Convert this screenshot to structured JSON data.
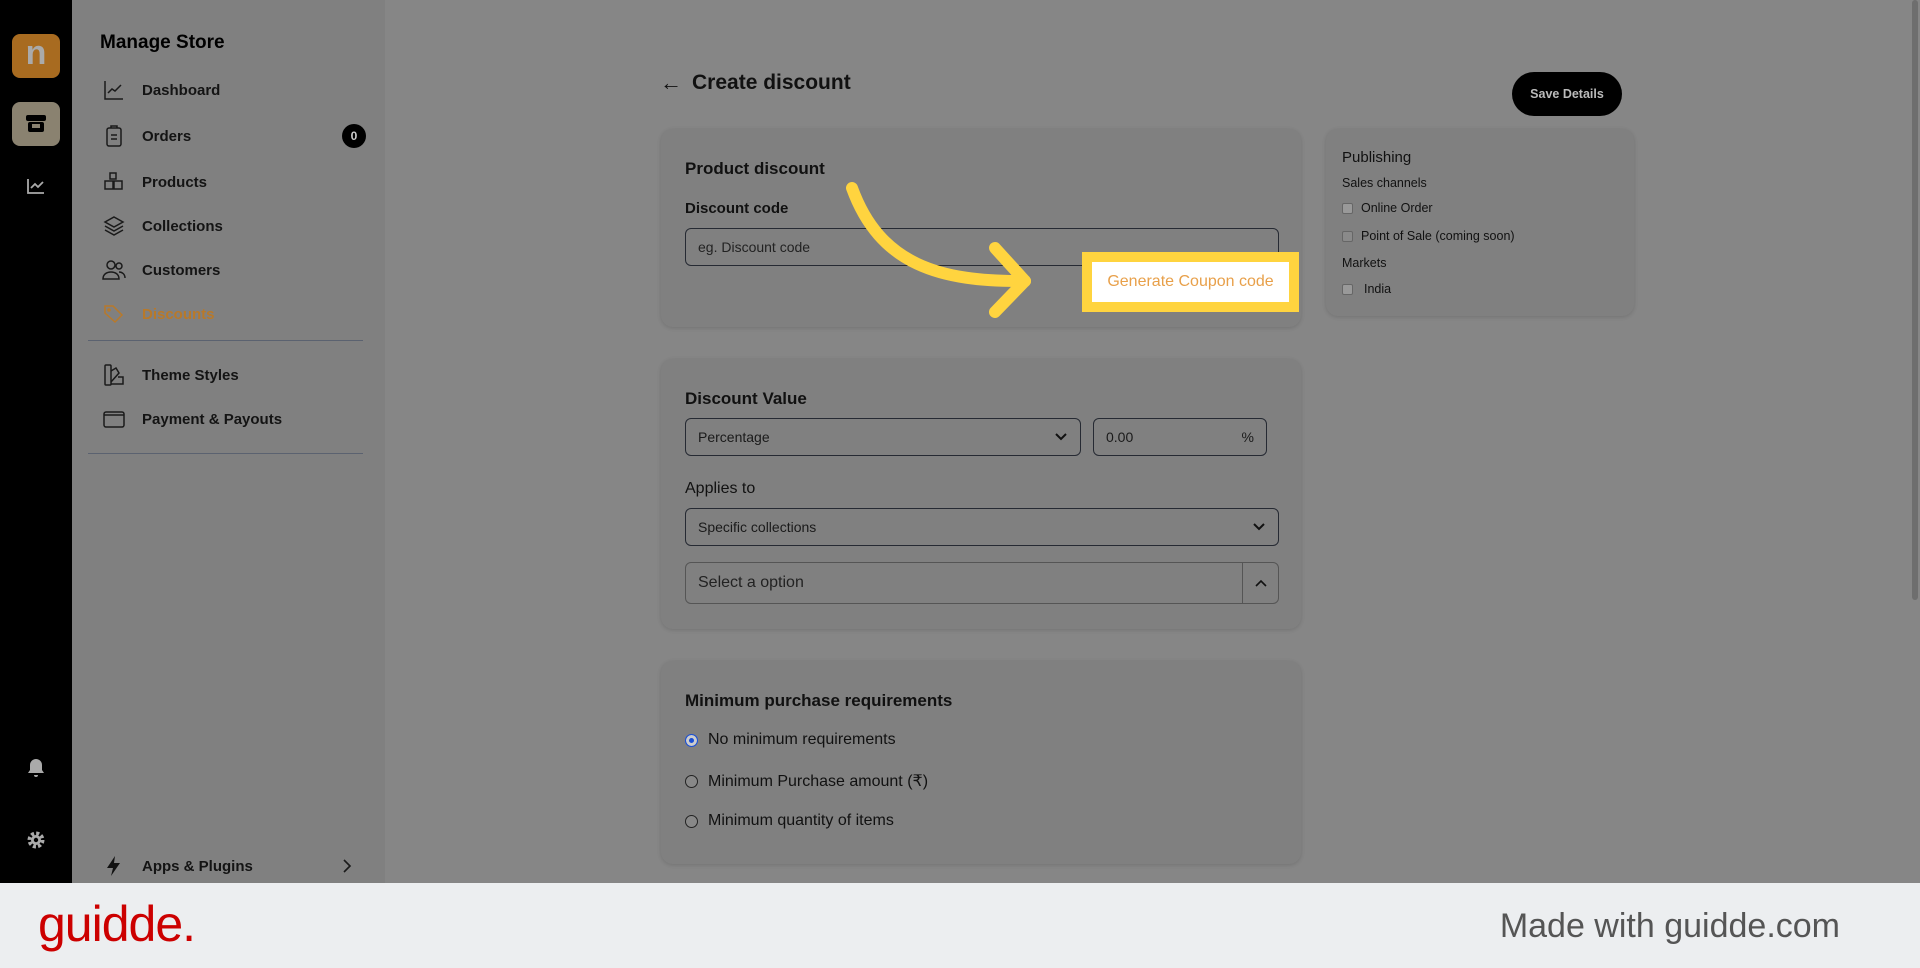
{
  "rail": {
    "logo_letter": "n",
    "icons": [
      "store-icon",
      "analytics-icon",
      "bell-icon",
      "gear-icon"
    ]
  },
  "sidebar": {
    "title": "Manage Store",
    "items": [
      {
        "label": "Dashboard",
        "icon": "chart-line-icon"
      },
      {
        "label": "Orders",
        "icon": "clipboard-icon",
        "badge": "0"
      },
      {
        "label": "Products",
        "icon": "boxes-icon"
      },
      {
        "label": "Collections",
        "icon": "layers-icon"
      },
      {
        "label": "Customers",
        "icon": "users-icon"
      },
      {
        "label": "Discounts",
        "icon": "tag-icon",
        "active": true
      },
      {
        "label": "Theme Styles",
        "icon": "palette-icon"
      },
      {
        "label": "Payment & Payouts",
        "icon": "wallet-icon"
      }
    ],
    "apps": {
      "label": "Apps & Plugins",
      "icon": "lightning-icon"
    }
  },
  "header": {
    "title": "Create discount",
    "save_label": "Save Details"
  },
  "product_discount": {
    "title": "Product discount",
    "code_label": "Discount code",
    "code_placeholder": "eg. Discount code",
    "generate_label": "Generate Coupon code"
  },
  "discount_value": {
    "title": "Discount Value",
    "type": "Percentage",
    "value": "0.00",
    "unit": "%",
    "applies_label": "Applies to",
    "applies_value": "Specific collections",
    "select_placeholder": "Select a option"
  },
  "min_purchase": {
    "title": "Minimum purchase requirements",
    "options": [
      {
        "label": "No minimum requirements",
        "selected": true
      },
      {
        "label": "Minimum Purchase amount (₹)",
        "selected": false
      },
      {
        "label": "Minimum quantity of items",
        "selected": false
      }
    ]
  },
  "publishing": {
    "title": "Publishing",
    "sales_label": "Sales channels",
    "channels": [
      {
        "label": "Online Order",
        "checked": true
      },
      {
        "label": "Point of Sale (coming soon)",
        "checked": false
      }
    ],
    "markets_label": "Markets",
    "markets": [
      {
        "label": "India",
        "checked": true
      }
    ]
  },
  "footer": {
    "brand": "guidde.",
    "credit": "Made with guidde.com"
  },
  "colors": {
    "accent": "#b8792a",
    "highlight": "#ffd43f",
    "generate_text": "#e8a04a",
    "brand_red": "#cc0000"
  }
}
